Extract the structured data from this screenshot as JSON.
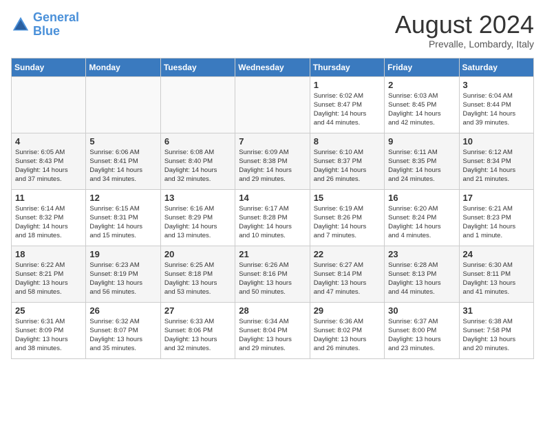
{
  "header": {
    "logo_line1": "General",
    "logo_line2": "Blue",
    "month_year": "August 2024",
    "location": "Prevalle, Lombardy, Italy"
  },
  "days_of_week": [
    "Sunday",
    "Monday",
    "Tuesday",
    "Wednesday",
    "Thursday",
    "Friday",
    "Saturday"
  ],
  "weeks": [
    [
      {
        "day": "",
        "info": ""
      },
      {
        "day": "",
        "info": ""
      },
      {
        "day": "",
        "info": ""
      },
      {
        "day": "",
        "info": ""
      },
      {
        "day": "1",
        "info": "Sunrise: 6:02 AM\nSunset: 8:47 PM\nDaylight: 14 hours\nand 44 minutes."
      },
      {
        "day": "2",
        "info": "Sunrise: 6:03 AM\nSunset: 8:45 PM\nDaylight: 14 hours\nand 42 minutes."
      },
      {
        "day": "3",
        "info": "Sunrise: 6:04 AM\nSunset: 8:44 PM\nDaylight: 14 hours\nand 39 minutes."
      }
    ],
    [
      {
        "day": "4",
        "info": "Sunrise: 6:05 AM\nSunset: 8:43 PM\nDaylight: 14 hours\nand 37 minutes."
      },
      {
        "day": "5",
        "info": "Sunrise: 6:06 AM\nSunset: 8:41 PM\nDaylight: 14 hours\nand 34 minutes."
      },
      {
        "day": "6",
        "info": "Sunrise: 6:08 AM\nSunset: 8:40 PM\nDaylight: 14 hours\nand 32 minutes."
      },
      {
        "day": "7",
        "info": "Sunrise: 6:09 AM\nSunset: 8:38 PM\nDaylight: 14 hours\nand 29 minutes."
      },
      {
        "day": "8",
        "info": "Sunrise: 6:10 AM\nSunset: 8:37 PM\nDaylight: 14 hours\nand 26 minutes."
      },
      {
        "day": "9",
        "info": "Sunrise: 6:11 AM\nSunset: 8:35 PM\nDaylight: 14 hours\nand 24 minutes."
      },
      {
        "day": "10",
        "info": "Sunrise: 6:12 AM\nSunset: 8:34 PM\nDaylight: 14 hours\nand 21 minutes."
      }
    ],
    [
      {
        "day": "11",
        "info": "Sunrise: 6:14 AM\nSunset: 8:32 PM\nDaylight: 14 hours\nand 18 minutes."
      },
      {
        "day": "12",
        "info": "Sunrise: 6:15 AM\nSunset: 8:31 PM\nDaylight: 14 hours\nand 15 minutes."
      },
      {
        "day": "13",
        "info": "Sunrise: 6:16 AM\nSunset: 8:29 PM\nDaylight: 14 hours\nand 13 minutes."
      },
      {
        "day": "14",
        "info": "Sunrise: 6:17 AM\nSunset: 8:28 PM\nDaylight: 14 hours\nand 10 minutes."
      },
      {
        "day": "15",
        "info": "Sunrise: 6:19 AM\nSunset: 8:26 PM\nDaylight: 14 hours\nand 7 minutes."
      },
      {
        "day": "16",
        "info": "Sunrise: 6:20 AM\nSunset: 8:24 PM\nDaylight: 14 hours\nand 4 minutes."
      },
      {
        "day": "17",
        "info": "Sunrise: 6:21 AM\nSunset: 8:23 PM\nDaylight: 14 hours\nand 1 minute."
      }
    ],
    [
      {
        "day": "18",
        "info": "Sunrise: 6:22 AM\nSunset: 8:21 PM\nDaylight: 13 hours\nand 58 minutes."
      },
      {
        "day": "19",
        "info": "Sunrise: 6:23 AM\nSunset: 8:19 PM\nDaylight: 13 hours\nand 56 minutes."
      },
      {
        "day": "20",
        "info": "Sunrise: 6:25 AM\nSunset: 8:18 PM\nDaylight: 13 hours\nand 53 minutes."
      },
      {
        "day": "21",
        "info": "Sunrise: 6:26 AM\nSunset: 8:16 PM\nDaylight: 13 hours\nand 50 minutes."
      },
      {
        "day": "22",
        "info": "Sunrise: 6:27 AM\nSunset: 8:14 PM\nDaylight: 13 hours\nand 47 minutes."
      },
      {
        "day": "23",
        "info": "Sunrise: 6:28 AM\nSunset: 8:13 PM\nDaylight: 13 hours\nand 44 minutes."
      },
      {
        "day": "24",
        "info": "Sunrise: 6:30 AM\nSunset: 8:11 PM\nDaylight: 13 hours\nand 41 minutes."
      }
    ],
    [
      {
        "day": "25",
        "info": "Sunrise: 6:31 AM\nSunset: 8:09 PM\nDaylight: 13 hours\nand 38 minutes."
      },
      {
        "day": "26",
        "info": "Sunrise: 6:32 AM\nSunset: 8:07 PM\nDaylight: 13 hours\nand 35 minutes."
      },
      {
        "day": "27",
        "info": "Sunrise: 6:33 AM\nSunset: 8:06 PM\nDaylight: 13 hours\nand 32 minutes."
      },
      {
        "day": "28",
        "info": "Sunrise: 6:34 AM\nSunset: 8:04 PM\nDaylight: 13 hours\nand 29 minutes."
      },
      {
        "day": "29",
        "info": "Sunrise: 6:36 AM\nSunset: 8:02 PM\nDaylight: 13 hours\nand 26 minutes."
      },
      {
        "day": "30",
        "info": "Sunrise: 6:37 AM\nSunset: 8:00 PM\nDaylight: 13 hours\nand 23 minutes."
      },
      {
        "day": "31",
        "info": "Sunrise: 6:38 AM\nSunset: 7:58 PM\nDaylight: 13 hours\nand 20 minutes."
      }
    ]
  ]
}
